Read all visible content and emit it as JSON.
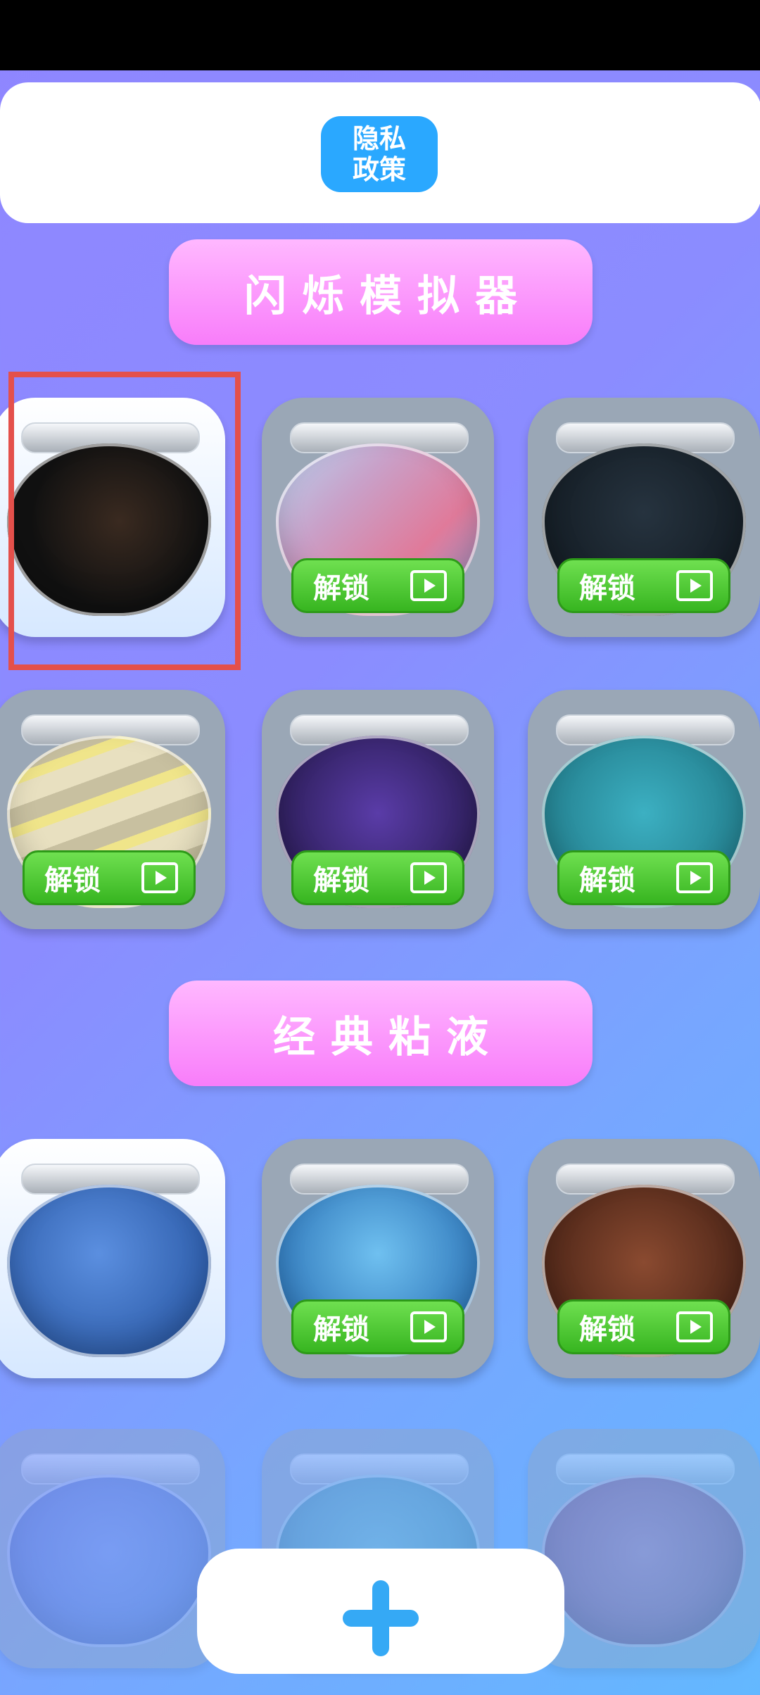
{
  "header": {
    "privacy_label": "隐私\n政策"
  },
  "sections": [
    {
      "title": "闪烁模拟器"
    },
    {
      "title": "经典粘液"
    }
  ],
  "jars": [
    {
      "name": "face-mask",
      "locked": false,
      "color": "#1a1a1a"
    },
    {
      "name": "rainbow-glitter",
      "locked": true,
      "color": "#b9a6c8",
      "unlock_label": "解锁"
    },
    {
      "name": "star-night",
      "locked": true,
      "color": "#1b2530",
      "unlock_label": "解锁"
    },
    {
      "name": "cream-swirl",
      "locked": true,
      "color": "#d9d2a8",
      "unlock_label": "解锁"
    },
    {
      "name": "purple-sparkle",
      "locked": true,
      "color": "#3a2a7a",
      "unlock_label": "解锁"
    },
    {
      "name": "teal-glitter",
      "locked": true,
      "color": "#2a8fa0",
      "unlock_label": "解锁"
    },
    {
      "name": "blue-slime",
      "locked": false,
      "color": "#3b6fc0"
    },
    {
      "name": "blue-marble",
      "locked": true,
      "color": "#3a8fd0",
      "unlock_label": "解锁"
    },
    {
      "name": "chocolate",
      "locked": true,
      "color": "#5a3020",
      "unlock_label": "解锁"
    }
  ],
  "colors": {
    "accent_blue": "#2aa8ff",
    "unlock_green": "#37b520",
    "title_pink": "#f87dfa",
    "selection_red": "#e4504b"
  }
}
